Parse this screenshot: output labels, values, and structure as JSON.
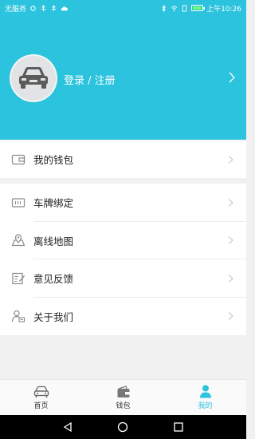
{
  "status_bar": {
    "carrier": "无服务",
    "time": "上午10:26"
  },
  "profile": {
    "login_text": "登录 / 注册"
  },
  "menu": {
    "wallet": "我的钱包",
    "plate_binding": "车牌绑定",
    "offline_map": "离线地图",
    "feedback": "意见反馈",
    "about": "关于我们"
  },
  "tabs": [
    {
      "label": "首页",
      "icon": "car-icon"
    },
    {
      "label": "钱包",
      "icon": "wallet-icon"
    },
    {
      "label": "我的",
      "icon": "person-icon",
      "active": true
    }
  ],
  "colors": {
    "brand": "#2bc3dd",
    "background": "#f1f1f1"
  }
}
